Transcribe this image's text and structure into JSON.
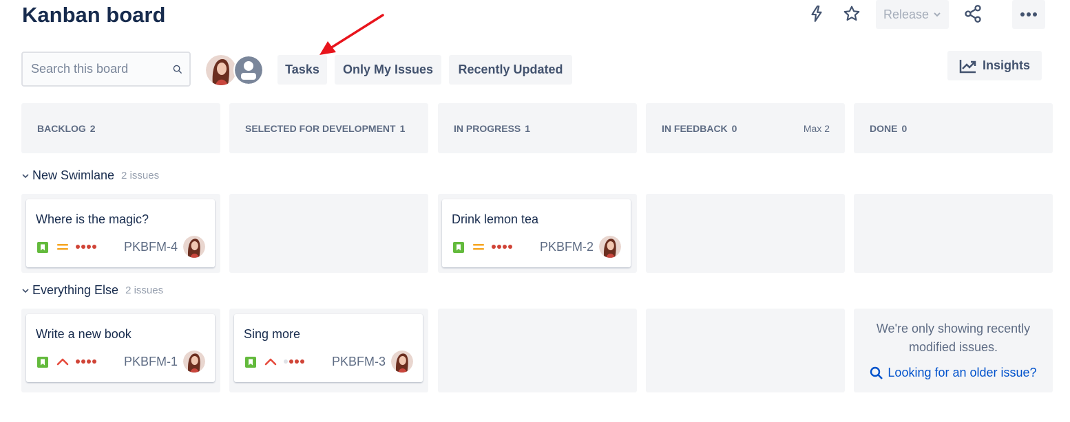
{
  "header": {
    "title": "Kanban board",
    "release_label": "Release",
    "icons": [
      "lightning-icon",
      "star-icon",
      "share-icon",
      "more-icon"
    ]
  },
  "toolbar": {
    "search_placeholder": "Search this board",
    "filters": [
      "Tasks",
      "Only My Issues",
      "Recently Updated"
    ],
    "insights_label": "Insights"
  },
  "columns": [
    {
      "name": "BACKLOG",
      "count": "2",
      "max": ""
    },
    {
      "name": "SELECTED FOR DEVELOPMENT",
      "count": "1",
      "max": ""
    },
    {
      "name": "IN PROGRESS",
      "count": "1",
      "max": ""
    },
    {
      "name": "IN FEEDBACK",
      "count": "0",
      "max": "Max 2"
    },
    {
      "name": "DONE",
      "count": "0",
      "max": ""
    }
  ],
  "swimlanes": [
    {
      "title": "New Swimlane",
      "count": "2 issues",
      "cards": [
        {
          "title": "Where is the magic?",
          "key": "PKBFM-4",
          "priority": "medium"
        },
        {
          "title": "Drink lemon tea",
          "key": "PKBFM-2",
          "priority": "medium"
        }
      ]
    },
    {
      "title": "Everything Else",
      "count": "2 issues",
      "cards": [
        {
          "title": "Write a new book",
          "key": "PKBFM-1",
          "priority": "high"
        },
        {
          "title": "Sing more",
          "key": "PKBFM-3",
          "priority": "high"
        }
      ]
    }
  ],
  "done_message": "We're only showing recently modified issues.",
  "older_issue_link": "Looking for an older issue?",
  "colors": {
    "accent": "#0052cc",
    "story": "#63ba3c",
    "priority_medium": "#f6a623",
    "priority_high": "#e5493a",
    "dots": "#d04437",
    "annotation_arrow": "#e8141c"
  }
}
